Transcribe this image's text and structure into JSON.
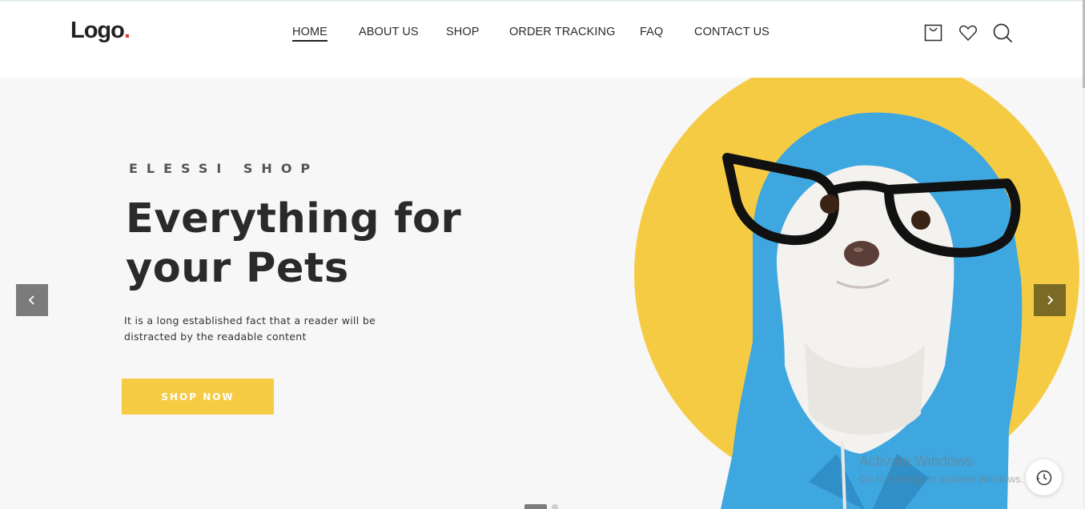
{
  "logo": {
    "text": "Logo",
    "dot": "."
  },
  "nav": {
    "items": [
      {
        "label": "HOME",
        "active": true
      },
      {
        "label": "ABOUT US"
      },
      {
        "label": "SHOP"
      },
      {
        "label": "ORDER TRACKING"
      },
      {
        "label": "FAQ"
      },
      {
        "label": "CONTACT US"
      }
    ]
  },
  "header_icons": [
    "cart-icon",
    "heart-icon",
    "search-icon"
  ],
  "hero": {
    "eyebrow": "ELESSI SHOP",
    "headline": "Everything for your Pets",
    "subtext": "It is a long established fact that a reader will be distracted by the readable content",
    "cta_label": "SHOP NOW",
    "prev_icon": "chevron-left-icon",
    "next_icon": "chevron-right-icon",
    "image": "dog-in-blue-hoodie-with-glasses"
  },
  "slider": {
    "total_slides": 2,
    "active_slide": 1
  },
  "watermark": {
    "line1": "Activate Windows",
    "line2": "Go to Settings to activate Windows."
  },
  "colors": {
    "accent_yellow": "#f6cb44",
    "hero_bg": "#f7f7f7",
    "hoodie_blue": "#3fa7e0",
    "logo_dot": "#e53935",
    "next_arrow": "#7b6a26",
    "prev_arrow": "#7b7b7b"
  }
}
